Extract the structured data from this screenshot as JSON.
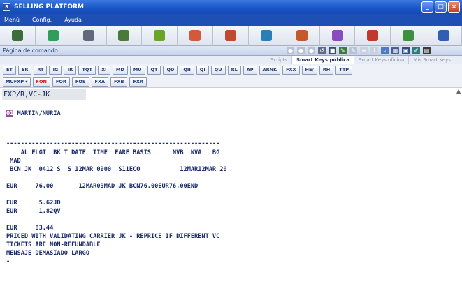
{
  "window": {
    "title": "SELLING PLATFORM",
    "app_icon": "S",
    "minimize": "_",
    "maximize": "□",
    "close": "×"
  },
  "menu": [
    "Menú",
    "Config.",
    "Ayuda"
  ],
  "toolbar_icons": [
    {
      "name": "terminal-icon",
      "color": "#3c6e3c"
    },
    {
      "name": "book-icon",
      "color": "#2f9e5a"
    },
    {
      "name": "network-icon",
      "color": "#606a7a"
    },
    {
      "name": "table-icon",
      "color": "#4a7a3a"
    },
    {
      "name": "globe-icon",
      "color": "#6aa52a"
    },
    {
      "name": "agent-icon",
      "color": "#d25a3a"
    },
    {
      "name": "agent-add-icon",
      "color": "#c04a30"
    },
    {
      "name": "car-icon",
      "color": "#2a7fb5"
    },
    {
      "name": "user-icon",
      "color": "#c45a2a"
    },
    {
      "name": "pencil-icon",
      "color": "#8a4ac0"
    },
    {
      "name": "umbrella-icon",
      "color": "#c0392b"
    },
    {
      "name": "doc-icon",
      "color": "#3f8f3f"
    },
    {
      "name": "info-icon",
      "color": "#2f5fb0"
    }
  ],
  "command_header": {
    "label": "Página de comando"
  },
  "smart_tabs": [
    {
      "label": "Scripts",
      "active": false
    },
    {
      "label": "Smart Keys pública",
      "active": true
    },
    {
      "label": "Smart Keys oficina",
      "active": false
    },
    {
      "label": "Mis Smart Keys",
      "active": false
    }
  ],
  "keys_row1": [
    "ET",
    "ER",
    "RT",
    "IG",
    "IR",
    "TQT",
    "XI",
    "MD",
    "MU",
    "QT",
    "QD",
    "QII",
    "QI",
    "QU",
    "RL",
    "AP",
    "ARNK",
    "FXX",
    "HE/",
    "RH",
    "TTP"
  ],
  "keys_row2": [
    {
      "label": "MUFXP ▾",
      "red": false
    },
    {
      "label": "FON",
      "red": true
    },
    {
      "label": "FOR",
      "red": false
    },
    {
      "label": "FOS",
      "red": false
    },
    {
      "label": "FXA",
      "red": false
    },
    {
      "label": "FXB",
      "red": false
    },
    {
      "label": "FXR",
      "red": false
    }
  ],
  "terminal": {
    "command": "FXP/R,VC-JK",
    "pax_num": "01",
    "pax_name": " MARTIN/NURIA",
    "lines": [
      "-----------------------------------------------------------",
      "    AL FLGT  BK T DATE  TIME  FARE BASIS      NVB  NVA   BG",
      " MAD",
      " BCN JK  0412 S  S 12MAR 0900  S11ECO           12MAR12MAR 20",
      "",
      "EUR     76.00       12MAR09MAD JK BCN76.00EUR76.00END",
      "",
      "EUR      5.62JD",
      "EUR      1.82QV",
      "",
      "EUR     83.44",
      "PRICED WITH VALIDATING CARRIER JK - REPRICE IF DIFFERENT VC",
      "TICKETS ARE NON-REFUNDABLE",
      "MENSAJE DEMASIADO LARGO",
      "-"
    ]
  }
}
